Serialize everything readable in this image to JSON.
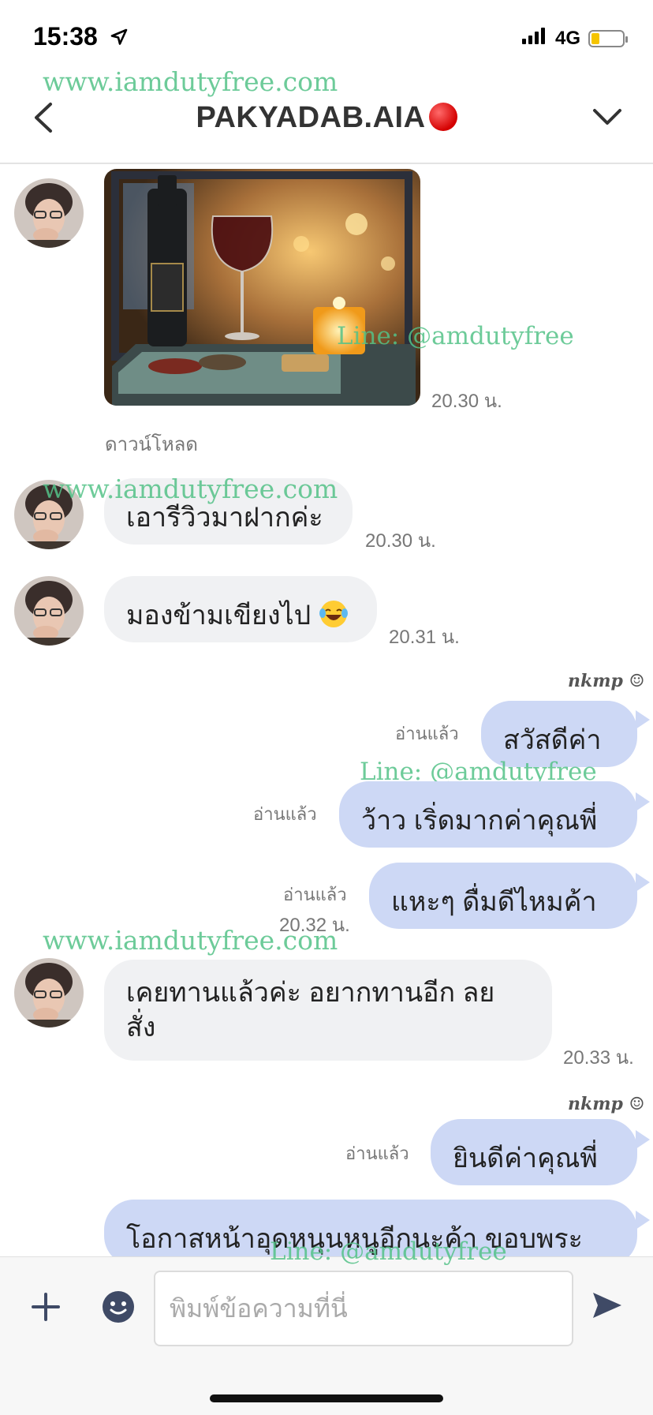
{
  "status_bar": {
    "time": "15:38",
    "network": "4G"
  },
  "header": {
    "title": "PAKYADAB.AIA"
  },
  "watermarks": {
    "website": "www.iamdutyfree.com",
    "line": "Line: @amdutyfree"
  },
  "messages": {
    "photo_time": "20.30 น.",
    "download_label": "ดาวน์โหลด",
    "m1": {
      "text": "เอารีวิวมาฝากค่ะ",
      "time": "20.30 น."
    },
    "m2": {
      "text": "มองข้ามเขียงไป",
      "time": "20.31 น."
    },
    "sender1": "nkmp",
    "m3": {
      "text": "สวัสดีค่า",
      "read": "อ่านแล้ว"
    },
    "m4": {
      "text": "ว้าว เริ่ดมากค่าคุณพี่",
      "read": "อ่านแล้ว"
    },
    "m5": {
      "text": "แหะๆ ดื่มดีไหมค้า",
      "read": "อ่านแล้ว",
      "time": "20.32 น."
    },
    "m6": {
      "text_line1": "เคยทานแล้วค่ะ อยากทานอีก ลย",
      "text_line2": "สั่ง",
      "time": "20.33 น."
    },
    "sender2": "nkmp",
    "m7": {
      "text": "ยินดีค่าคุณพี่",
      "read": "อ่านแล้ว"
    },
    "m8": {
      "text": "โอกาสหน้าอุดหนุนหนูอีกนะค้า ขอบพระ"
    }
  },
  "input": {
    "placeholder": "พิมพ์ข้อความที่นี่"
  },
  "colors": {
    "outgoing_bubble": "#cdd8f5",
    "incoming_bubble": "#f0f1f3",
    "watermark": "#54c288"
  }
}
